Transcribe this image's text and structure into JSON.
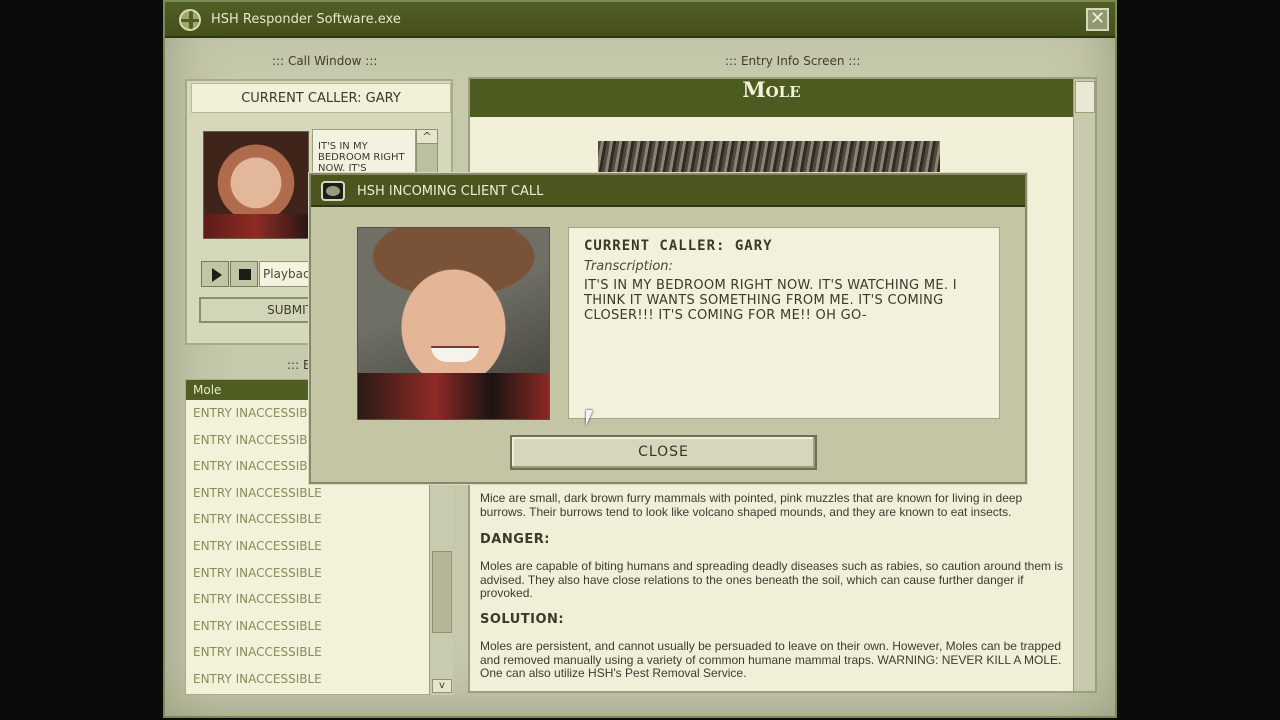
{
  "window": {
    "title": "HSH Responder Software.exe",
    "close_glyph": "✕"
  },
  "call_window": {
    "label": "::: Call Window :::",
    "current_caller": "CURRENT CALLER: GARY",
    "preview_text": "IT'S IN MY BEDROOM RIGHT NOW. IT'S",
    "scroll_up": "^",
    "playback_placeholder": "Playback",
    "submit_label": "SUBMIT"
  },
  "entries_label": "::: En",
  "entries": [
    "Mole",
    "ENTRY INACCESSIBLE",
    "ENTRY INACCESSIBLE",
    "ENTRY INACCESSIBLE",
    "ENTRY INACCESSIBLE",
    "ENTRY INACCESSIBLE",
    "ENTRY INACCESSIBLE",
    "ENTRY INACCESSIBLE",
    "ENTRY INACCESSIBLE",
    "ENTRY INACCESSIBLE",
    "ENTRY INACCESSIBLE",
    "ENTRY INACCESSIBLE"
  ],
  "entries_scroll_down": "v",
  "entry_info": {
    "label": "::: Entry Info Screen :::",
    "title": "Mole",
    "description": "Mice are small, dark brown furry mammals with pointed, pink muzzles that are known for living in deep burrows. Their burrows tend to look like volcano shaped mounds, and they are known to eat insects.",
    "danger_heading": "DANGER:",
    "danger_text": "Moles are capable of biting humans and spreading deadly diseases such as rabies, so caution around them is advised. They also have close relations to the ones beneath the soil, which can cause further danger if provoked.",
    "solution_heading": "SOLUTION:",
    "solution_text": "Moles are persistent, and cannot usually be persuaded to leave on their own. However, Moles can be trapped and removed manually using a variety of common humane mammal traps. WARNING: NEVER KILL A MOLE. One can also utilize HSH's Pest Removal Service."
  },
  "incoming_call": {
    "title": "HSH INCOMING CLIENT CALL",
    "caller": "CURRENT CALLER: GARY",
    "transcription_label": "Transcription:",
    "transcription": "IT'S IN MY BEDROOM RIGHT NOW. IT'S WATCHING ME. I THINK IT WANTS SOMETHING FROM ME. IT'S COMING CLOSER!!! IT'S COMING FOR ME!! OH GO-",
    "close_label": "CLOSE"
  }
}
